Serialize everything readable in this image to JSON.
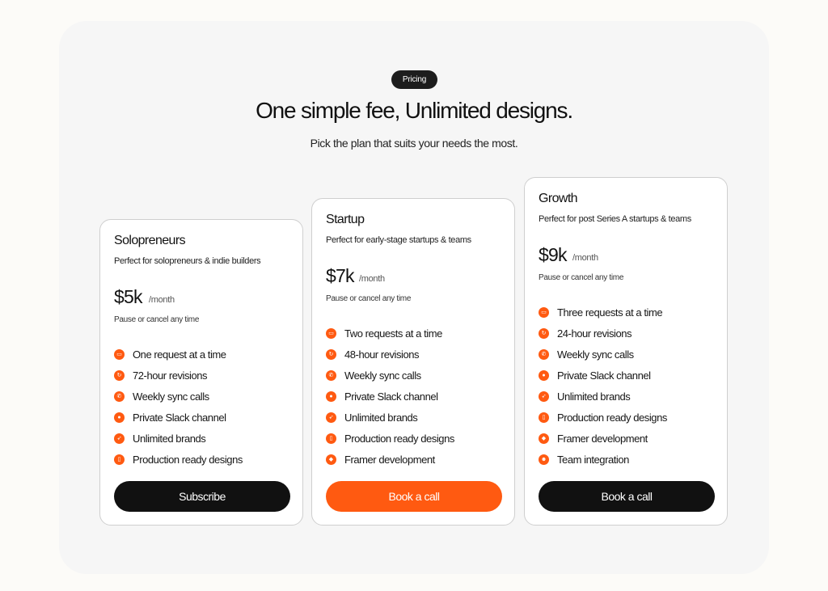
{
  "header": {
    "pill": "Pricing",
    "headline": "One simple fee, Unlimited designs.",
    "subhead": "Pick the plan that suits your needs the most."
  },
  "colors": {
    "accent": "#ff5a11",
    "dark": "#111111",
    "panel": "#f6f6f6"
  },
  "plans": [
    {
      "title": "Solopreneurs",
      "desc": "Perfect for solopreneurs & indie builders",
      "price": "$5k",
      "period": "/month",
      "note": "Pause or cancel any time",
      "features": [
        {
          "icon": "inbox-icon",
          "glyph": "▭",
          "text": "One request at a time"
        },
        {
          "icon": "refresh-icon",
          "glyph": "↻",
          "text": "72-hour revisions"
        },
        {
          "icon": "phone-icon",
          "glyph": "✆",
          "text": "Weekly sync calls"
        },
        {
          "icon": "chat-icon",
          "glyph": "●",
          "text": "Private Slack channel"
        },
        {
          "icon": "rocket-icon",
          "glyph": "➶",
          "text": "Unlimited brands"
        },
        {
          "icon": "device-icon",
          "glyph": "▯",
          "text": "Production ready designs"
        }
      ],
      "cta": "Subscribe"
    },
    {
      "title": "Startup",
      "desc": "Perfect for early-stage startups & teams",
      "price": "$7k",
      "period": "/month",
      "note": "Pause or cancel any time",
      "features": [
        {
          "icon": "inbox-icon",
          "glyph": "▭",
          "text": "Two requests at a time"
        },
        {
          "icon": "refresh-icon",
          "glyph": "↻",
          "text": "48-hour revisions"
        },
        {
          "icon": "phone-icon",
          "glyph": "✆",
          "text": "Weekly sync calls"
        },
        {
          "icon": "chat-icon",
          "glyph": "●",
          "text": "Private Slack channel"
        },
        {
          "icon": "rocket-icon",
          "glyph": "➶",
          "text": "Unlimited brands"
        },
        {
          "icon": "device-icon",
          "glyph": "▯",
          "text": "Production ready designs"
        },
        {
          "icon": "framer-icon",
          "glyph": "◆",
          "text": "Framer development"
        }
      ],
      "cta": "Book a call"
    },
    {
      "title": "Growth",
      "desc": "Perfect for post Series A startups & teams",
      "price": "$9k",
      "period": "/month",
      "note": "Pause or cancel any time",
      "features": [
        {
          "icon": "inbox-icon",
          "glyph": "▭",
          "text": "Three requests at a time"
        },
        {
          "icon": "refresh-icon",
          "glyph": "↻",
          "text": "24-hour revisions"
        },
        {
          "icon": "phone-icon",
          "glyph": "✆",
          "text": "Weekly sync calls"
        },
        {
          "icon": "chat-icon",
          "glyph": "●",
          "text": "Private Slack channel"
        },
        {
          "icon": "rocket-icon",
          "glyph": "➶",
          "text": "Unlimited brands"
        },
        {
          "icon": "device-icon",
          "glyph": "▯",
          "text": "Production ready designs"
        },
        {
          "icon": "framer-icon",
          "glyph": "◆",
          "text": "Framer development"
        },
        {
          "icon": "team-icon",
          "glyph": "☻",
          "text": "Team integration"
        }
      ],
      "cta": "Book a call"
    }
  ]
}
